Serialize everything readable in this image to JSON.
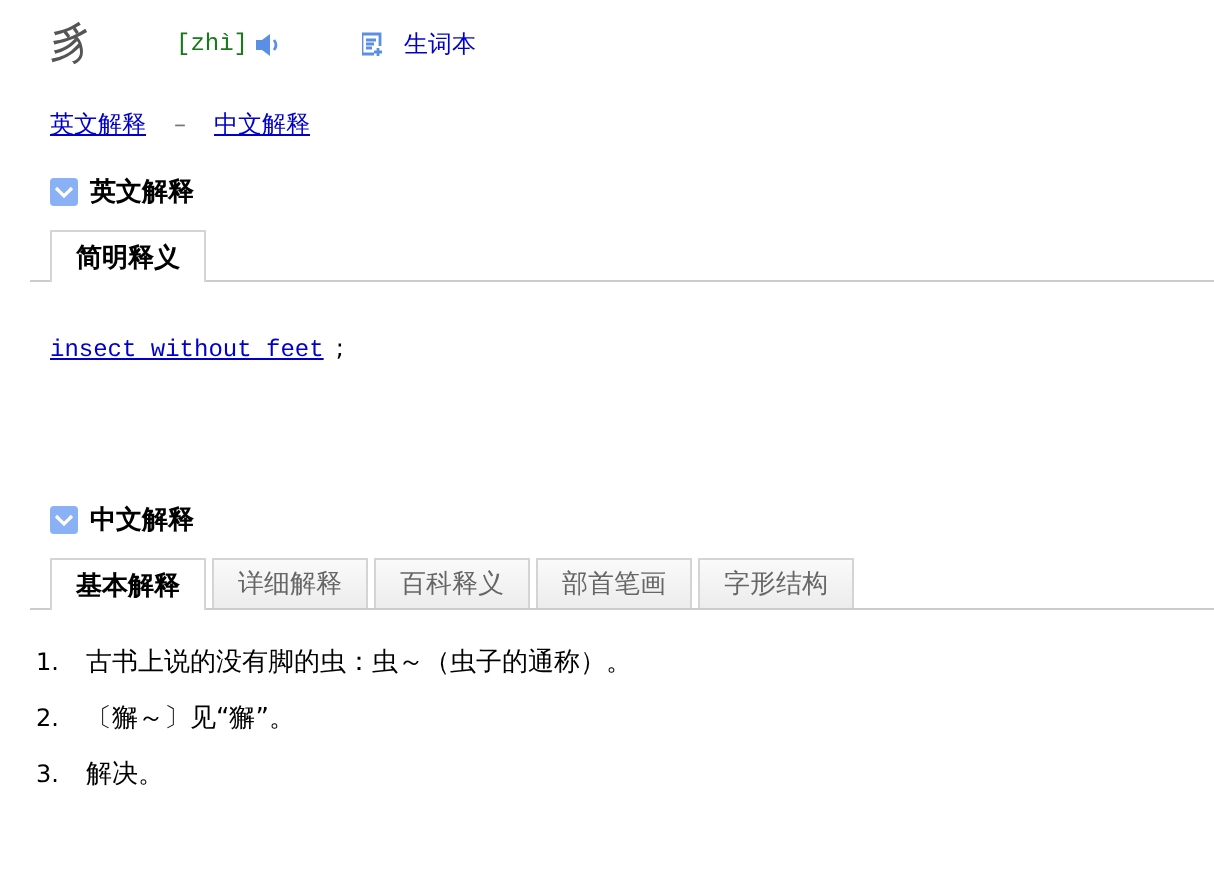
{
  "headword": {
    "character": "豸",
    "pinyin": "[zhì]",
    "wordbook": "生词本"
  },
  "jump_links": [
    {
      "label": "英文解释"
    },
    {
      "label": "中文解释"
    }
  ],
  "separator": "–",
  "english_section": {
    "title": "英文解释",
    "expanded": true,
    "tabs": [
      {
        "label": "简明释义",
        "selected": true
      }
    ],
    "definition": {
      "link": "insect without feet",
      "punct": ";"
    }
  },
  "chinese_section": {
    "title": "中文解释",
    "expanded": true,
    "tabs": [
      {
        "label": "基本解释",
        "selected": true
      },
      {
        "label": "详细解释",
        "selected": false
      },
      {
        "label": "百科释义",
        "selected": false
      },
      {
        "label": "部首笔画",
        "selected": false
      },
      {
        "label": "字形结构",
        "selected": false
      }
    ],
    "items": [
      {
        "number": "1.",
        "text": "古书上说的没有脚的虫：虫～（虫子的通称）。"
      },
      {
        "number": "2.",
        "text": "〔獬～〕见“獬”。"
      },
      {
        "number": "3.",
        "text": "解决。"
      }
    ]
  }
}
